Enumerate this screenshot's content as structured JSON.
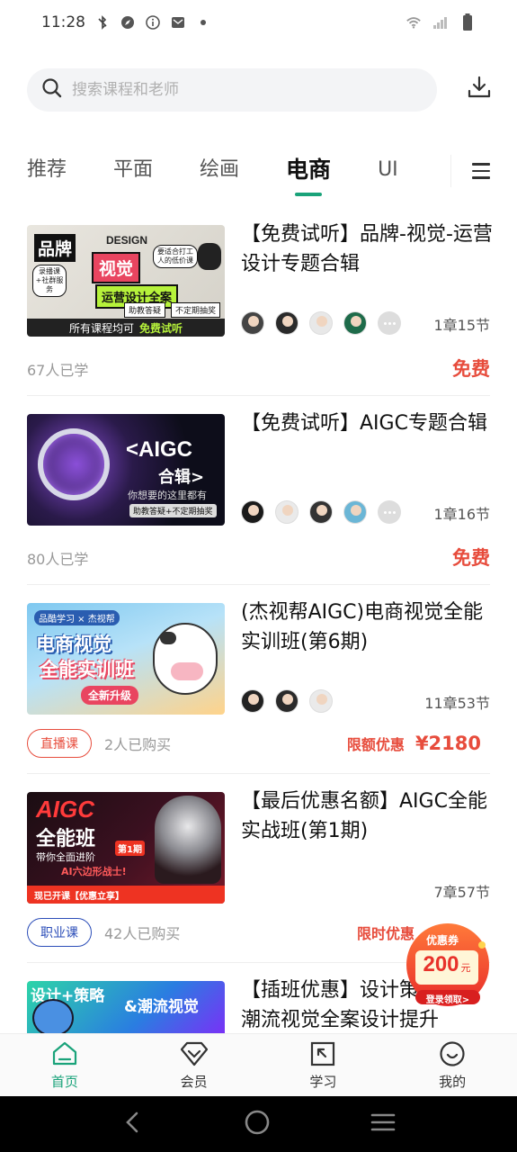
{
  "status": {
    "time": "11:28"
  },
  "search": {
    "placeholder": "搜索课程和老师"
  },
  "tabs": [
    {
      "label": "推荐"
    },
    {
      "label": "平面"
    },
    {
      "label": "绘画"
    },
    {
      "label": "电商",
      "active": true
    },
    {
      "label": "UI"
    }
  ],
  "courses": [
    {
      "title": "【免费试听】品牌-视觉-运营设计专题合辑",
      "lessons": "1章15节",
      "students": "67人已学",
      "price": "免费",
      "thumb": {
        "line1": "品牌",
        "line2": "视觉",
        "line3": "运营设计全案",
        "badge": "所有课程均可",
        "badge2": "免费试听",
        "side1": "助教答疑",
        "side2": "不定期抽奖",
        "tag_left": "录播课+社群服务",
        "tag_right": "要适合打工人的低价课",
        "design": "DESIGN"
      }
    },
    {
      "title": "【免费试听】AIGC专题合辑",
      "lessons": "1章16节",
      "students": "80人已学",
      "price": "免费",
      "thumb": {
        "line1": "<AIGC",
        "line2": "合辑>",
        "line3": "你想要的这里都有",
        "line4": "助教答疑+不定期抽奖"
      }
    },
    {
      "title": "(杰视帮AIGC)电商视觉全能实训班(第6期)",
      "lessons": "11章53节",
      "tag": "直播课",
      "buyers": "2人已购买",
      "promo": "限额优惠",
      "amount": "¥2180",
      "thumb": {
        "line0": "品酷学习 × 杰视帮",
        "line1": "电商视觉",
        "line2": "全能实训班",
        "line3": "全新升级"
      }
    },
    {
      "title": "【最后优惠名额】AIGC全能实战班(第1期)",
      "lessons": "7章57节",
      "tag": "职业课",
      "buyers": "42人已购买",
      "promo": "限时优惠",
      "thumb": {
        "line1": "AIGC",
        "line2": "全能班",
        "line3": "带你全面进阶",
        "line4": "AI六边形战士!",
        "badge": "第1期",
        "bottom": "现已开课【优惠立享】"
      }
    },
    {
      "title": "【插班优惠】设计策略&潮流视觉全案设计提升班...",
      "thumb": {
        "line1": "设计+策略",
        "line2": "&潮流视觉"
      }
    }
  ],
  "coupon": {
    "title": "优惠券",
    "amount": "200",
    "unit": "元",
    "cta": "登录领取>"
  },
  "bottom_nav": [
    {
      "label": "首页",
      "icon": "home-icon",
      "active": true
    },
    {
      "label": "会员",
      "icon": "diamond-icon"
    },
    {
      "label": "学习",
      "icon": "study-icon"
    },
    {
      "label": "我的",
      "icon": "profile-icon"
    }
  ],
  "colors": {
    "accent": "#1aa37a",
    "price_red": "#e74c3c",
    "job_blue": "#2b4db8"
  }
}
